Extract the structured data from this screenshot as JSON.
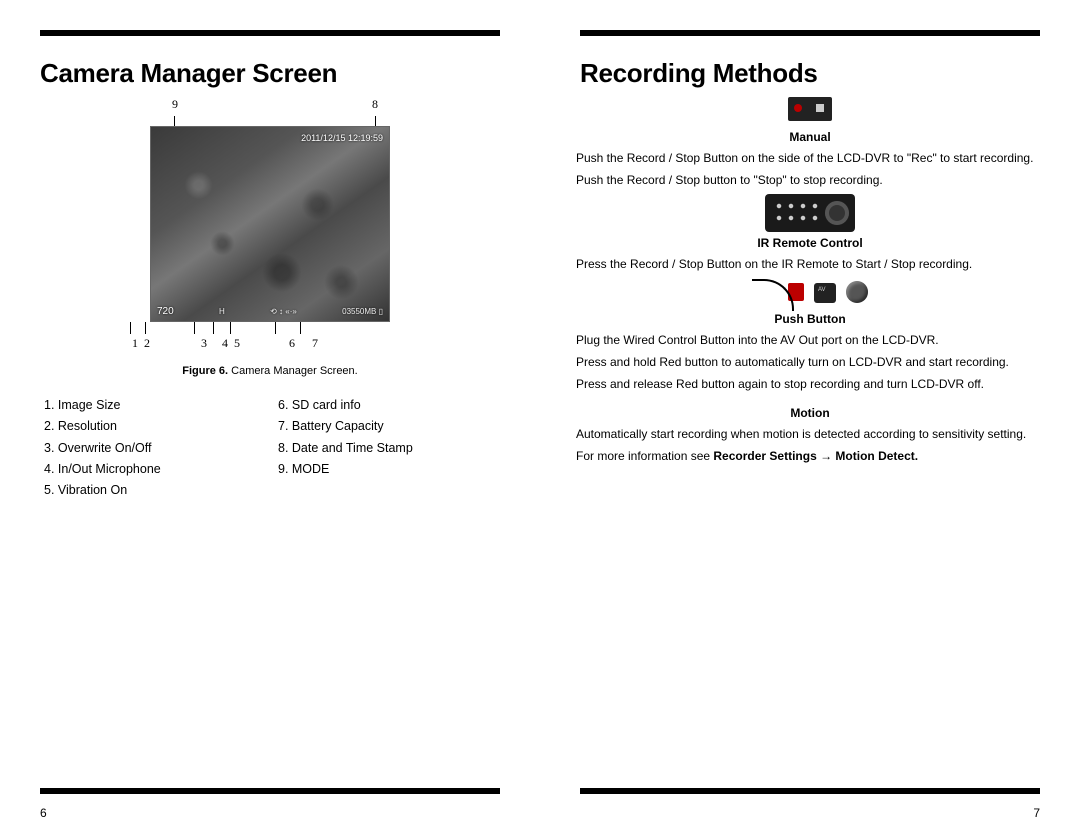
{
  "left": {
    "title": "Camera Manager Screen",
    "callouts_top": [
      "9",
      "8"
    ],
    "callouts_bottom": [
      "1",
      "2",
      "3",
      "4",
      "5",
      "6",
      "7"
    ],
    "osd_datetime": "2011/12/15  12:19:59",
    "osd_bottom_left": "720",
    "osd_bottom_mid1": "H",
    "osd_bottom_mid2": "⟲  ↕  «·»",
    "osd_bottom_right": "03550MB ▯",
    "caption_label": "Figure 6.",
    "caption_text": " Camera Manager Screen.",
    "legend_col1": [
      "1. Image Size",
      "2. Resolution",
      "3. Overwrite On/Off",
      "4. In/Out Microphone",
      "5. Vibration On"
    ],
    "legend_col2": [
      "6. SD card info",
      "7. Battery Capacity",
      "8. Date and Time Stamp",
      "9. MODE"
    ],
    "page_number": "6"
  },
  "right": {
    "title": "Recording Methods",
    "sections": {
      "manual": {
        "label": "Manual",
        "p1": "Push the Record / Stop Button on the side of the LCD-DVR to \"Rec\" to start recording.",
        "p2": "Push the Record / Stop button to \"Stop\" to stop recording."
      },
      "ir": {
        "label": "IR Remote Control",
        "p1": "Press the Record / Stop Button on the IR Remote to Start / Stop recording."
      },
      "push": {
        "label": "Push Button",
        "p1": "Plug the Wired Control Button into the AV Out port on the LCD-DVR.",
        "p2": "Press and hold Red button to automatically turn on LCD-DVR and start recording.",
        "p3": "Press and release Red button again to stop recording and turn LCD-DVR off."
      },
      "motion": {
        "label": "Motion",
        "p1": "Automatically start recording when motion is detected according to sensitivity setting.",
        "p2_pre": "For more information see ",
        "p2_bold": "Recorder Settings → Motion Detect."
      }
    },
    "page_number": "7"
  }
}
